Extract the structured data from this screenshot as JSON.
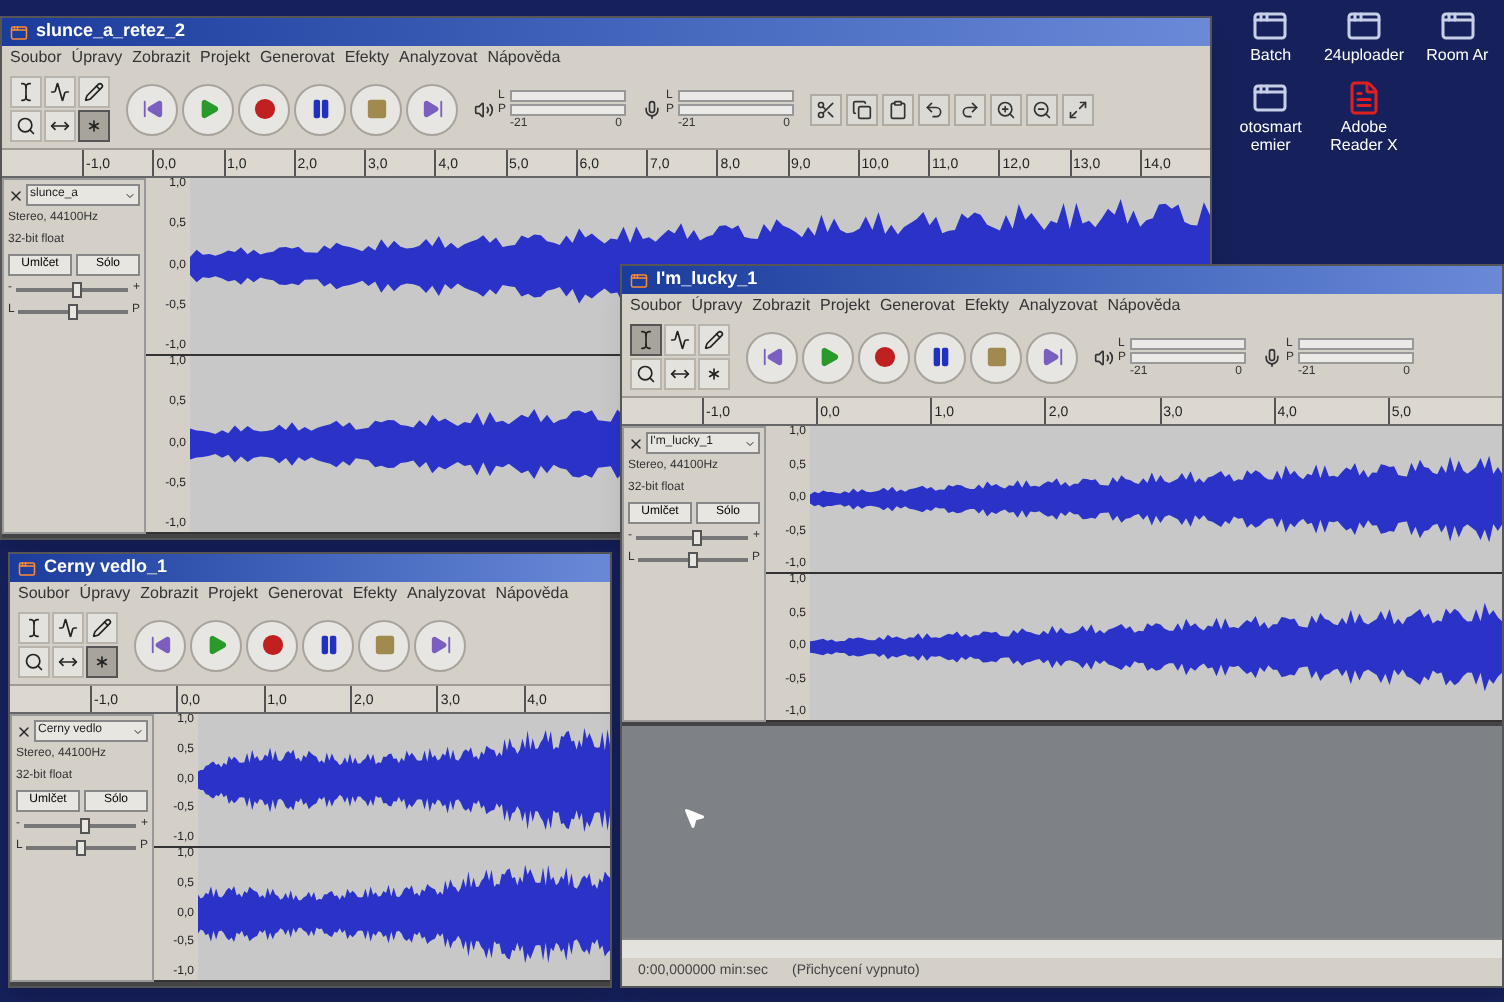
{
  "windows": [
    {
      "title": "slunce_a_retez_2",
      "menu": [
        "Soubor",
        "Úpravy",
        "Zobrazit",
        "Projekt",
        "Generovat",
        "Efekty",
        "Analyzovat",
        "Nápověda"
      ],
      "tools": [
        {
          "kind": "select",
          "selected": false
        },
        {
          "kind": "envelope",
          "selected": false
        },
        {
          "kind": "draw",
          "selected": false
        },
        {
          "kind": "zoom",
          "selected": false
        },
        {
          "kind": "timeshift",
          "selected": false
        },
        {
          "kind": "multi",
          "selected": true
        }
      ],
      "transport": [
        {
          "kind": "start"
        },
        {
          "kind": "play"
        },
        {
          "kind": "record"
        },
        {
          "kind": "pause"
        },
        {
          "kind": "stop"
        },
        {
          "kind": "end"
        }
      ],
      "meters": [
        {
          "kind": "playback",
          "channels": [
            "L",
            "P"
          ],
          "ticks": [
            "-21",
            "0"
          ]
        },
        {
          "kind": "recording",
          "channels": [
            "L",
            "P"
          ],
          "ticks": [
            "-21",
            "0"
          ]
        }
      ],
      "edit_tools": [
        {
          "kind": "cut"
        },
        {
          "kind": "copy"
        },
        {
          "kind": "paste"
        },
        {
          "kind": "undo"
        },
        {
          "kind": "redo"
        },
        {
          "kind": "zoom-in"
        },
        {
          "kind": "zoom-out"
        },
        {
          "kind": "fit"
        }
      ],
      "ruler": [
        "-1,0",
        "0,0",
        "1,0",
        "2,0",
        "3,0",
        "4,0",
        "5,0",
        "6,0",
        "7,0",
        "8,0",
        "9,0",
        "10,0",
        "11,0",
        "12,0",
        "13,0",
        "14,0"
      ],
      "tracks": [
        {
          "name": "slunce_a",
          "format": "Stereo, 44100Hz",
          "bits": "32-bit float",
          "mute": "Umlčet",
          "solo": "Sólo",
          "gain": {
            "min": "-",
            "max": "+",
            "level": 0.55
          },
          "pan": {
            "min": "L",
            "max": "P",
            "level": 0.5
          },
          "channels": [
            {
              "scale": [
                "1,0",
                "0,5",
                "0,0",
                "-0,5",
                "-1,0"
              ]
            },
            {
              "scale": [
                "1,0",
                "0,5",
                "0,0",
                "-0,5",
                "-1,0"
              ]
            }
          ]
        }
      ]
    },
    {
      "title": "Cerny vedlo_1",
      "menu": [
        "Soubor",
        "Úpravy",
        "Zobrazit",
        "Projekt",
        "Generovat",
        "Efekty",
        "Analyzovat",
        "Nápověda"
      ],
      "tools": [
        {
          "kind": "select",
          "selected": false
        },
        {
          "kind": "envelope",
          "selected": false
        },
        {
          "kind": "draw",
          "selected": false
        },
        {
          "kind": "zoom",
          "selected": false
        },
        {
          "kind": "timeshift",
          "selected": false
        },
        {
          "kind": "multi",
          "selected": true
        }
      ],
      "transport": [
        {
          "kind": "start"
        },
        {
          "kind": "play"
        },
        {
          "kind": "record"
        },
        {
          "kind": "pause"
        },
        {
          "kind": "stop"
        },
        {
          "kind": "end"
        }
      ],
      "ruler": [
        "-1,0",
        "0,0",
        "1,0",
        "2,0",
        "3,0",
        "4,0"
      ],
      "tracks": [
        {
          "name": "Cerny vedlo",
          "format": "Stereo, 44100Hz",
          "bits": "32-bit float",
          "mute": "Umlčet",
          "solo": "Sólo",
          "gain": {
            "min": "-",
            "max": "+",
            "level": 0.55
          },
          "pan": {
            "min": "L",
            "max": "P",
            "level": 0.5
          },
          "channels": [
            {
              "scale": [
                "1,0",
                "0,5",
                "0,0",
                "-0,5",
                "-1,0"
              ]
            },
            {
              "scale": [
                "1,0",
                "0,5",
                "0,0",
                "-0,5",
                "-1,0"
              ]
            }
          ]
        }
      ]
    },
    {
      "title": "I'm_lucky_1",
      "menu": [
        "Soubor",
        "Úpravy",
        "Zobrazit",
        "Projekt",
        "Generovat",
        "Efekty",
        "Analyzovat",
        "Nápověda"
      ],
      "tools": [
        {
          "kind": "select",
          "selected": true
        },
        {
          "kind": "envelope",
          "selected": false
        },
        {
          "kind": "draw",
          "selected": false
        },
        {
          "kind": "zoom",
          "selected": false
        },
        {
          "kind": "timeshift",
          "selected": false
        },
        {
          "kind": "multi",
          "selected": false
        }
      ],
      "transport": [
        {
          "kind": "start"
        },
        {
          "kind": "play"
        },
        {
          "kind": "record"
        },
        {
          "kind": "pause"
        },
        {
          "kind": "stop"
        },
        {
          "kind": "end"
        }
      ],
      "meters": [
        {
          "kind": "playback",
          "channels": [
            "L",
            "P"
          ],
          "ticks": [
            "-21",
            "0"
          ]
        },
        {
          "kind": "recording",
          "channels": [
            "L",
            "P"
          ],
          "ticks": [
            "-21",
            "0"
          ]
        }
      ],
      "ruler": [
        "-1,0",
        "0,0",
        "1,0",
        "2,0",
        "3,0",
        "4,0",
        "5,0"
      ],
      "tracks": [
        {
          "name": "I'm_lucky_1",
          "format": "Stereo, 44100Hz",
          "bits": "32-bit float",
          "mute": "Umlčet",
          "solo": "Sólo",
          "gain": {
            "min": "-",
            "max": "+",
            "level": 0.55
          },
          "pan": {
            "min": "L",
            "max": "P",
            "level": 0.5
          },
          "channels": [
            {
              "scale": [
                "1,0",
                "0,5",
                "0,0",
                "-0,5",
                "-1,0"
              ]
            },
            {
              "scale": [
                "1,0",
                "0,5",
                "0,0",
                "-0,5",
                "-1,0"
              ]
            }
          ]
        }
      ],
      "status_bar": [
        "0:00,000000 min:sec",
        "(Přichycení vypnuto)"
      ]
    }
  ],
  "desktop_icons": [
    {
      "label": "Batch",
      "kind": "app"
    },
    {
      "label": "24uploader",
      "kind": "app"
    },
    {
      "label": "Room Ar",
      "kind": "app"
    },
    {
      "label": "otosmart emier",
      "kind": "app"
    },
    {
      "label": "Adobe Reader X",
      "kind": "pdf"
    }
  ]
}
